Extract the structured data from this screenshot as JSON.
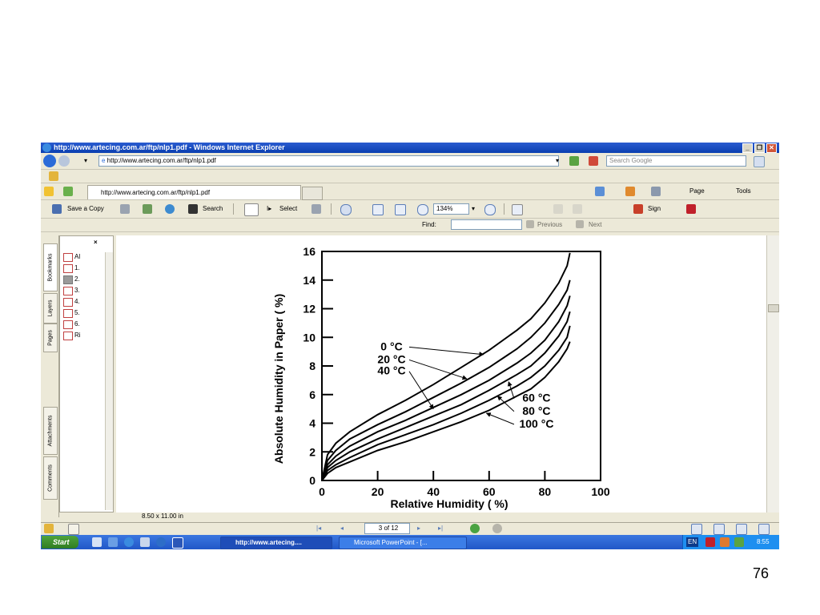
{
  "window": {
    "title": "http://www.artecing.com.ar/ftp/nlp1.pdf - Windows Internet Explorer"
  },
  "address": {
    "url": "http://www.artecing.com.ar/ftp/nlp1.pdf",
    "search_placeholder": "Search Google"
  },
  "tab": {
    "label": "http://www.artecing.com.ar/ftp/nlp1.pdf"
  },
  "ie_toolbar": {
    "page": "Page",
    "tools": "Tools"
  },
  "pdf_toolbar": {
    "save_copy": "Save a Copy",
    "search": "Search",
    "select": "Select",
    "zoom": "134%",
    "sign": "Sign"
  },
  "find": {
    "label": "Find:",
    "previous": "Previous",
    "next": "Next"
  },
  "sidebar": {
    "tabs": [
      "Bookmarks",
      "Layers",
      "Pages",
      "Attachments",
      "Comments"
    ],
    "bookmarks": [
      "Al",
      "1.",
      "2.",
      "3.",
      "4.",
      "5.",
      "6.",
      "Ri"
    ]
  },
  "status": {
    "page_size": "8.50 x 11.00 in",
    "page_indicator": "3 of 12"
  },
  "taskbar": {
    "start": "Start",
    "tasks": [
      "http://www.artecing....",
      "Microsoft PowerPoint - [..."
    ],
    "lang": "EN",
    "clock": "8:55"
  },
  "slide_number": "76",
  "colors": {
    "titlebar": "#0a3fb0",
    "taskbar": "#2157c8",
    "chrome": "#ece9d8"
  },
  "chart_data": {
    "type": "line",
    "xlabel": "Relative  Humidity ( %)",
    "ylabel": "Absolute Humidity in Paper ( %)",
    "xlim": [
      0,
      100
    ],
    "ylim": [
      0,
      16
    ],
    "x_ticks": [
      0,
      20,
      40,
      60,
      80,
      100
    ],
    "y_ticks": [
      0,
      2,
      4,
      6,
      8,
      10,
      12,
      14,
      16
    ],
    "series": [
      {
        "name": "0 °C",
        "x": [
          0,
          2,
          5,
          10,
          20,
          30,
          40,
          50,
          60,
          70,
          75,
          80,
          85,
          88,
          89
        ],
        "y": [
          0,
          1.8,
          2.6,
          3.4,
          4.6,
          5.6,
          6.7,
          7.9,
          9.1,
          10.5,
          11.3,
          12.4,
          13.8,
          15.0,
          15.9
        ]
      },
      {
        "name": "20 °C",
        "x": [
          0,
          2,
          5,
          10,
          20,
          30,
          40,
          50,
          60,
          70,
          75,
          80,
          85,
          88,
          89
        ],
        "y": [
          0,
          1.4,
          2.1,
          2.9,
          3.9,
          4.8,
          5.8,
          6.8,
          7.9,
          9.2,
          10.0,
          11.0,
          12.3,
          13.3,
          14.0
        ]
      },
      {
        "name": "40 °C",
        "x": [
          0,
          2,
          5,
          10,
          20,
          30,
          40,
          50,
          60,
          70,
          75,
          80,
          85,
          88,
          89
        ],
        "y": [
          0,
          1.1,
          1.7,
          2.4,
          3.4,
          4.2,
          5.1,
          6.0,
          7.0,
          8.2,
          8.9,
          9.8,
          11.1,
          12.2,
          12.9
        ]
      },
      {
        "name": "60 °C",
        "x": [
          0,
          2,
          5,
          10,
          20,
          30,
          40,
          50,
          60,
          70,
          75,
          80,
          85,
          88,
          89
        ],
        "y": [
          0,
          0.9,
          1.4,
          2.0,
          2.9,
          3.7,
          4.5,
          5.3,
          6.3,
          7.4,
          8.0,
          8.9,
          10.1,
          11.1,
          11.8
        ]
      },
      {
        "name": "80 °C",
        "x": [
          0,
          2,
          5,
          10,
          20,
          30,
          40,
          50,
          60,
          70,
          75,
          80,
          85,
          88,
          89
        ],
        "y": [
          0,
          0.7,
          1.1,
          1.6,
          2.5,
          3.2,
          3.9,
          4.7,
          5.6,
          6.6,
          7.2,
          8.0,
          9.1,
          10.0,
          10.8
        ]
      },
      {
        "name": "100 °C",
        "x": [
          0,
          2,
          5,
          10,
          20,
          30,
          40,
          50,
          60,
          70,
          75,
          80,
          85,
          88,
          89
        ],
        "y": [
          0,
          0.5,
          0.9,
          1.3,
          2.1,
          2.7,
          3.4,
          4.1,
          4.9,
          5.9,
          6.4,
          7.2,
          8.3,
          9.2,
          9.7
        ]
      }
    ],
    "annotations": [
      {
        "text": "0 °C",
        "label_x": 25,
        "label_y": 9.1,
        "arrow_x": 58,
        "arrow_y": 8.8
      },
      {
        "text": "20 °C",
        "label_x": 25,
        "label_y": 8.2,
        "arrow_x": 52,
        "arrow_y": 7.1
      },
      {
        "text": "40 °C",
        "label_x": 25,
        "label_y": 7.4,
        "arrow_x": 40,
        "arrow_y": 5.0
      },
      {
        "text": "60 °C",
        "label_x": 77,
        "label_y": 5.5,
        "arrow_x": 67,
        "arrow_y": 6.9
      },
      {
        "text": "80 °C",
        "label_x": 77,
        "label_y": 4.6,
        "arrow_x": 63,
        "arrow_y": 5.9
      },
      {
        "text": "100 °C",
        "label_x": 77,
        "label_y": 3.7,
        "arrow_x": 59,
        "arrow_y": 4.7
      }
    ],
    "grid": false
  }
}
